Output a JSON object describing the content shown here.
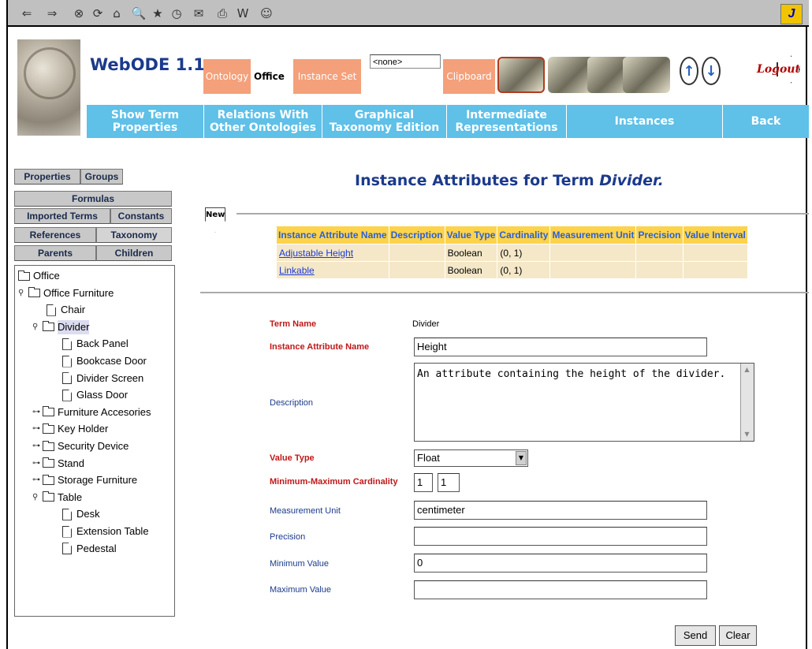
{
  "browser_toolbar": {
    "icons": [
      "back-arrow-icon",
      "forward-arrow-icon",
      "stop-icon",
      "refresh-icon",
      "home-icon",
      "search-icon",
      "favorites-icon",
      "history-icon",
      "mail-icon",
      "print-icon",
      "edit-icon",
      "messenger-icon"
    ],
    "glyphs": [
      "⇐",
      "⇒",
      "⊗",
      "⟳",
      "⌂",
      "🔍",
      "★",
      "◷",
      "✉",
      "⎙",
      "W",
      "☺"
    ],
    "logo_text": "J"
  },
  "header": {
    "brand": "WebODE 1.1",
    "ontology_label": "Ontology",
    "ontology_value": "Office",
    "instance_set_label": "Instance Set",
    "instance_set_value": "<none>",
    "clipboard_label": "Clipboard",
    "logout_label": "Logout"
  },
  "nav": [
    {
      "label": "Show Term Properties"
    },
    {
      "label": "Relations With Other Ontologies"
    },
    {
      "label": "Graphical Taxonomy Edition"
    },
    {
      "label": "Intermediate Representations"
    },
    {
      "label": "Instances"
    },
    {
      "label": "Back"
    }
  ],
  "side_tabs": {
    "properties": "Properties",
    "groups": "Groups",
    "formulas": "Formulas",
    "imported_terms": "Imported Terms",
    "constants": "Constants",
    "references": "References",
    "taxonomy": "Taxonomy",
    "parents": "Parents",
    "children": "Children"
  },
  "tree": [
    {
      "label": "Office",
      "kind": "folder",
      "level": 0,
      "exp": ""
    },
    {
      "label": "Office Furniture",
      "kind": "folder",
      "level": 0,
      "exp": "open"
    },
    {
      "label": "Chair",
      "kind": "doc",
      "level": 1,
      "exp": ""
    },
    {
      "label": "Divider",
      "kind": "folder",
      "level": 1,
      "exp": "open",
      "selected": true
    },
    {
      "label": "Back Panel",
      "kind": "doc",
      "level": 2,
      "exp": ""
    },
    {
      "label": "Bookcase Door",
      "kind": "doc",
      "level": 2,
      "exp": ""
    },
    {
      "label": "Divider Screen",
      "kind": "doc",
      "level": 2,
      "exp": ""
    },
    {
      "label": "Glass Door",
      "kind": "doc",
      "level": 2,
      "exp": ""
    },
    {
      "label": "Furniture Accesories",
      "kind": "folder",
      "level": 1,
      "exp": "closed"
    },
    {
      "label": "Key Holder",
      "kind": "folder",
      "level": 1,
      "exp": "closed"
    },
    {
      "label": "Security Device",
      "kind": "folder",
      "level": 1,
      "exp": "closed"
    },
    {
      "label": "Stand",
      "kind": "folder",
      "level": 1,
      "exp": "closed"
    },
    {
      "label": "Storage Furniture",
      "kind": "folder",
      "level": 1,
      "exp": "closed"
    },
    {
      "label": "Table",
      "kind": "folder",
      "level": 1,
      "exp": "open"
    },
    {
      "label": "Desk",
      "kind": "doc",
      "level": 2,
      "exp": ""
    },
    {
      "label": "Extension Table",
      "kind": "doc",
      "level": 2,
      "exp": ""
    },
    {
      "label": "Pedestal",
      "kind": "doc",
      "level": 2,
      "exp": ""
    }
  ],
  "main": {
    "title_prefix": "Instance Attributes for Term ",
    "title_term": "Divider.",
    "new_label": "New",
    "table": {
      "headers": [
        "Instance Attribute Name",
        "Description",
        "Value Type",
        "Cardinality",
        "Measurement Unit",
        "Precision",
        "Value Interval"
      ],
      "rows": [
        [
          "Adjustable Height",
          "",
          "Boolean",
          "(0, 1)",
          "",
          "",
          ""
        ],
        [
          "Linkable",
          "",
          "Boolean",
          "(0, 1)",
          "",
          "",
          ""
        ]
      ]
    },
    "form": {
      "term_name_label": "Term Name",
      "term_name_value": "Divider",
      "attr_name_label": "Instance Attribute Name",
      "attr_name_value": "Height",
      "description_label": "Description",
      "description_value": "An attribute containing the height of the divider.",
      "value_type_label": "Value Type",
      "value_type_value": "Float",
      "cardinality_label": "Minimum-Maximum Cardinality",
      "card_min": "1",
      "card_max": "1",
      "unit_label": "Measurement Unit",
      "unit_value": "centimeter",
      "precision_label": "Precision",
      "precision_value": "",
      "min_label": "Minimum Value",
      "min_value": "0",
      "max_label": "Maximum Value",
      "max_value": "",
      "send_label": "Send",
      "clear_label": "Clear"
    }
  }
}
